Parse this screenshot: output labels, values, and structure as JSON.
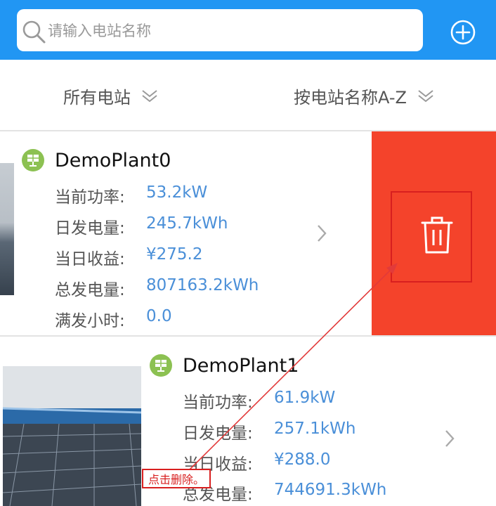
{
  "search": {
    "placeholder": "请输入电站名称"
  },
  "filters": {
    "station_filter": "所有电站",
    "sort_filter": "按电站名称A-Z"
  },
  "plants": [
    {
      "name": "DemoPlant0",
      "rows": [
        {
          "label": "当前功率:",
          "value": "53.2kW"
        },
        {
          "label": "日发电量:",
          "value": "245.7kWh"
        },
        {
          "label": "当日收益:",
          "value": "¥275.2"
        },
        {
          "label": "总发电量:",
          "value": "807163.2kWh"
        },
        {
          "label": "满发小时:",
          "value": "0.0"
        }
      ]
    },
    {
      "name": "DemoPlant1",
      "rows": [
        {
          "label": "当前功率:",
          "value": "61.9kW"
        },
        {
          "label": "日发电量:",
          "value": "257.1kWh"
        },
        {
          "label": "当日收益:",
          "value": "¥288.0"
        },
        {
          "label": "总发电量:",
          "value": "744691.3kWh"
        }
      ]
    }
  ],
  "annotation": {
    "text": "点击删除。"
  },
  "colors": {
    "topbar": "#2196f3",
    "delete": "#f4432b",
    "value_blue": "#4a8fd8",
    "annotation_red": "#d81f1f"
  }
}
